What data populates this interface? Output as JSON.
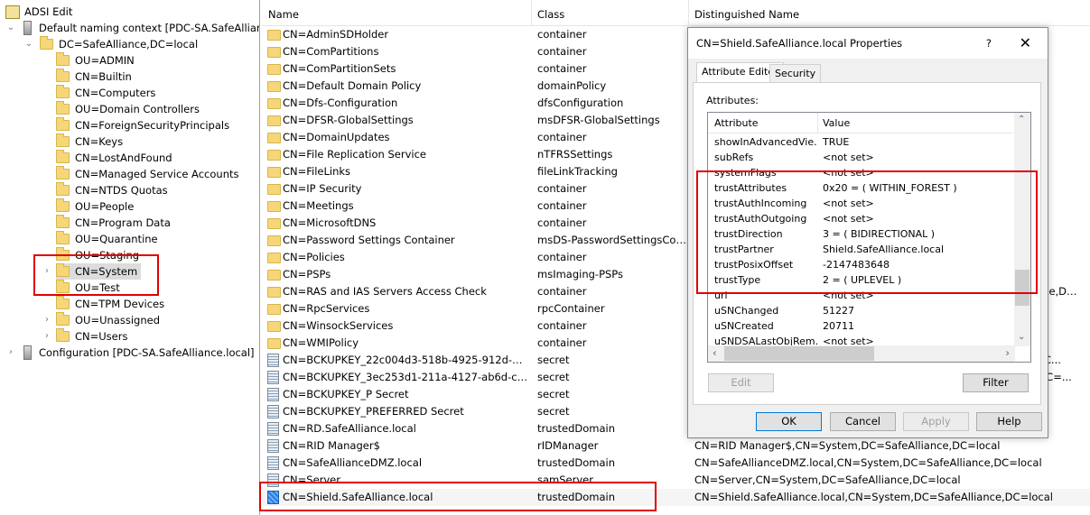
{
  "tree": {
    "root": "ADSI Edit",
    "contexts": [
      {
        "label": "Default naming context [PDC-SA.SafeAlliance.local]"
      },
      {
        "label": "Configuration [PDC-SA.SafeAlliance.local]"
      }
    ],
    "domain": "DC=SafeAlliance,DC=local",
    "items": [
      {
        "label": "OU=ADMIN",
        "expandable": false
      },
      {
        "label": "CN=Builtin",
        "expandable": false
      },
      {
        "label": "CN=Computers",
        "expandable": false
      },
      {
        "label": "OU=Domain Controllers",
        "expandable": false
      },
      {
        "label": "CN=ForeignSecurityPrincipals",
        "expandable": false
      },
      {
        "label": "CN=Keys",
        "expandable": false
      },
      {
        "label": "CN=LostAndFound",
        "expandable": false
      },
      {
        "label": "CN=Managed Service Accounts",
        "expandable": false
      },
      {
        "label": "CN=NTDS Quotas",
        "expandable": false
      },
      {
        "label": "OU=People",
        "expandable": false
      },
      {
        "label": "CN=Program Data",
        "expandable": false
      },
      {
        "label": "OU=Quarantine",
        "expandable": false
      },
      {
        "label": "OU=Staging",
        "expandable": false
      },
      {
        "label": "CN=System",
        "expandable": true,
        "selected": true
      },
      {
        "label": "OU=Test",
        "expandable": false
      },
      {
        "label": "CN=TPM Devices",
        "expandable": false
      },
      {
        "label": "OU=Unassigned",
        "expandable": true
      },
      {
        "label": "CN=Users",
        "expandable": true
      }
    ]
  },
  "list": {
    "columns": [
      "Name",
      "Class",
      "Distinguished Name"
    ],
    "rows": [
      {
        "name": "CN=AdminSDHolder",
        "class": "container",
        "icon": "folder"
      },
      {
        "name": "CN=ComPartitions",
        "class": "container",
        "icon": "folder"
      },
      {
        "name": "CN=ComPartitionSets",
        "class": "container",
        "icon": "folder"
      },
      {
        "name": "CN=Default Domain Policy",
        "class": "domainPolicy",
        "icon": "folder"
      },
      {
        "name": "CN=Dfs-Configuration",
        "class": "dfsConfiguration",
        "icon": "folder"
      },
      {
        "name": "CN=DFSR-GlobalSettings",
        "class": "msDFSR-GlobalSettings",
        "icon": "folder"
      },
      {
        "name": "CN=DomainUpdates",
        "class": "container",
        "icon": "folder"
      },
      {
        "name": "CN=File Replication Service",
        "class": "nTFRSSettings",
        "icon": "folder"
      },
      {
        "name": "CN=FileLinks",
        "class": "fileLinkTracking",
        "icon": "folder"
      },
      {
        "name": "CN=IP Security",
        "class": "container",
        "icon": "folder"
      },
      {
        "name": "CN=Meetings",
        "class": "container",
        "icon": "folder"
      },
      {
        "name": "CN=MicrosoftDNS",
        "class": "container",
        "icon": "folder"
      },
      {
        "name": "CN=Password Settings Container",
        "class": "msDS-PasswordSettingsCont...",
        "icon": "folder"
      },
      {
        "name": "CN=Policies",
        "class": "container",
        "icon": "folder"
      },
      {
        "name": "CN=PSPs",
        "class": "msImaging-PSPs",
        "icon": "folder"
      },
      {
        "name": "CN=RAS and IAS Servers Access Check",
        "class": "container",
        "icon": "folder",
        "dn": "CN=RAS and IAS Servers Access Check,CN=System,DC=SafeAlliance,DC=local"
      },
      {
        "name": "CN=RpcServices",
        "class": "rpcContainer",
        "icon": "folder"
      },
      {
        "name": "CN=WinsockServices",
        "class": "container",
        "icon": "folder"
      },
      {
        "name": "CN=WMIPolicy",
        "class": "container",
        "icon": "folder"
      },
      {
        "name": "CN=BCKUPKEY_22c004d3-518b-4925-912d-69525...",
        "class": "secret",
        "icon": "doc",
        "dn": "CN=BCKUPKEY_22c004d3-518b-4925-912d-69525...,CN=System,DC..."
      },
      {
        "name": "CN=BCKUPKEY_3ec253d1-211a-4127-ab6d-c23f86...",
        "class": "secret",
        "icon": "doc",
        "dn": "CN=BCKUPKEY_3ec253d1-211a-4127-ab6d-c23f86...,CN=System,DC=..."
      },
      {
        "name": "CN=BCKUPKEY_P Secret",
        "class": "secret",
        "icon": "doc"
      },
      {
        "name": "CN=BCKUPKEY_PREFERRED Secret",
        "class": "secret",
        "icon": "doc"
      },
      {
        "name": "CN=RD.SafeAlliance.local",
        "class": "trustedDomain",
        "icon": "doc"
      },
      {
        "name": "CN=RID Manager$",
        "class": "rIDManager",
        "icon": "doc",
        "dn": "CN=RID Manager$,CN=System,DC=SafeAlliance,DC=local"
      },
      {
        "name": "CN=SafeAllianceDMZ.local",
        "class": "trustedDomain",
        "icon": "doc",
        "dn": "CN=SafeAllianceDMZ.local,CN=System,DC=SafeAlliance,DC=local"
      },
      {
        "name": "CN=Server",
        "class": "samServer",
        "icon": "doc",
        "dn": "CN=Server,CN=System,DC=SafeAlliance,DC=local"
      },
      {
        "name": "CN=Shield.SafeAlliance.local",
        "class": "trustedDomain",
        "icon": "doc-blue",
        "dn": "CN=Shield.SafeAlliance.local,CN=System,DC=SafeAlliance,DC=local",
        "selected": true
      }
    ]
  },
  "dialog": {
    "title": "CN=Shield.SafeAlliance.local Properties",
    "help": "?",
    "tabs": [
      "Attribute Editor",
      "Security"
    ],
    "attributes_label": "Attributes:",
    "columns": [
      "Attribute",
      "Value"
    ],
    "attributes": [
      {
        "name": "showInAdvancedVie...",
        "value": "TRUE"
      },
      {
        "name": "subRefs",
        "value": "<not set>"
      },
      {
        "name": "systemFlags",
        "value": "<not set>"
      },
      {
        "name": "trustAttributes",
        "value": "0x20 = ( WITHIN_FOREST )"
      },
      {
        "name": "trustAuthIncoming",
        "value": "<not set>"
      },
      {
        "name": "trustAuthOutgoing",
        "value": "<not set>"
      },
      {
        "name": "trustDirection",
        "value": "3 = ( BIDIRECTIONAL )"
      },
      {
        "name": "trustPartner",
        "value": "Shield.SafeAlliance.local"
      },
      {
        "name": "trustPosixOffset",
        "value": "-2147483648"
      },
      {
        "name": "trustType",
        "value": "2 = ( UPLEVEL )"
      },
      {
        "name": "url",
        "value": "<not set>"
      },
      {
        "name": "uSNChanged",
        "value": "51227"
      },
      {
        "name": "uSNCreated",
        "value": "20711"
      },
      {
        "name": "uSNDSALastObjRem...",
        "value": "<not set>"
      }
    ],
    "buttons": {
      "edit": "Edit",
      "filter": "Filter",
      "ok": "OK",
      "cancel": "Cancel",
      "apply": "Apply",
      "help": "Help"
    }
  },
  "colors": {
    "highlight": "#e00000",
    "folder": "#f5d77a",
    "selection": "#dcdcdc"
  }
}
